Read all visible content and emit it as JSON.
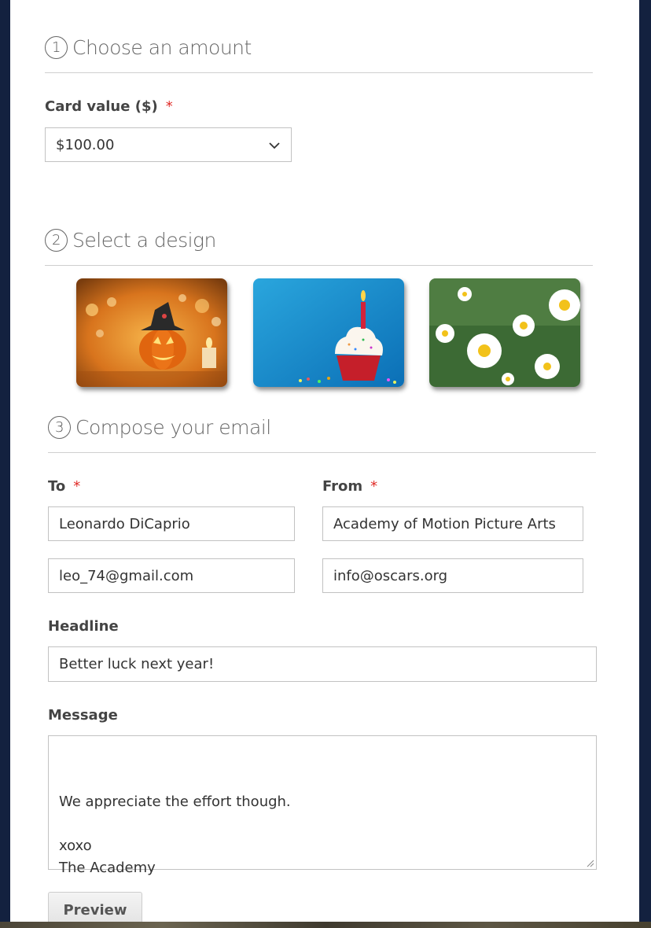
{
  "sections": {
    "amount": {
      "number": "1",
      "title": "Choose an amount"
    },
    "design": {
      "number": "2",
      "title": "Select a design"
    },
    "compose": {
      "number": "3",
      "title": "Compose your email"
    }
  },
  "amount_form": {
    "card_value_label": "Card value ($)",
    "required_mark": "*",
    "card_value_selected": "$100.00"
  },
  "designs": [
    {
      "name": "halloween-card-image",
      "selected": false
    },
    {
      "name": "birthday-cupcake-card-image",
      "selected": false
    },
    {
      "name": "daisy-flowers-card-image",
      "selected": false
    }
  ],
  "compose_form": {
    "to_label": "To",
    "from_label": "From",
    "required_mark": "*",
    "to_name": "Leonardo DiCaprio",
    "to_email": "leo_74@gmail.com",
    "from_name": "Academy of Motion Picture Arts",
    "from_email": "info@oscars.org",
    "headline_label": "Headline",
    "headline_value": "Better luck next year!",
    "message_label": "Message",
    "message_value": "We appreciate the effort though.\n\nxoxo\nThe Academy",
    "preview_button": "Preview"
  },
  "icons": {
    "select_arrow": "chevron-down-icon",
    "resize": "resize-grip-icon"
  },
  "colors": {
    "page_background": "#13213f",
    "panel": "#ffffff",
    "required": "#e02b27",
    "border": "#c2c2c2"
  }
}
